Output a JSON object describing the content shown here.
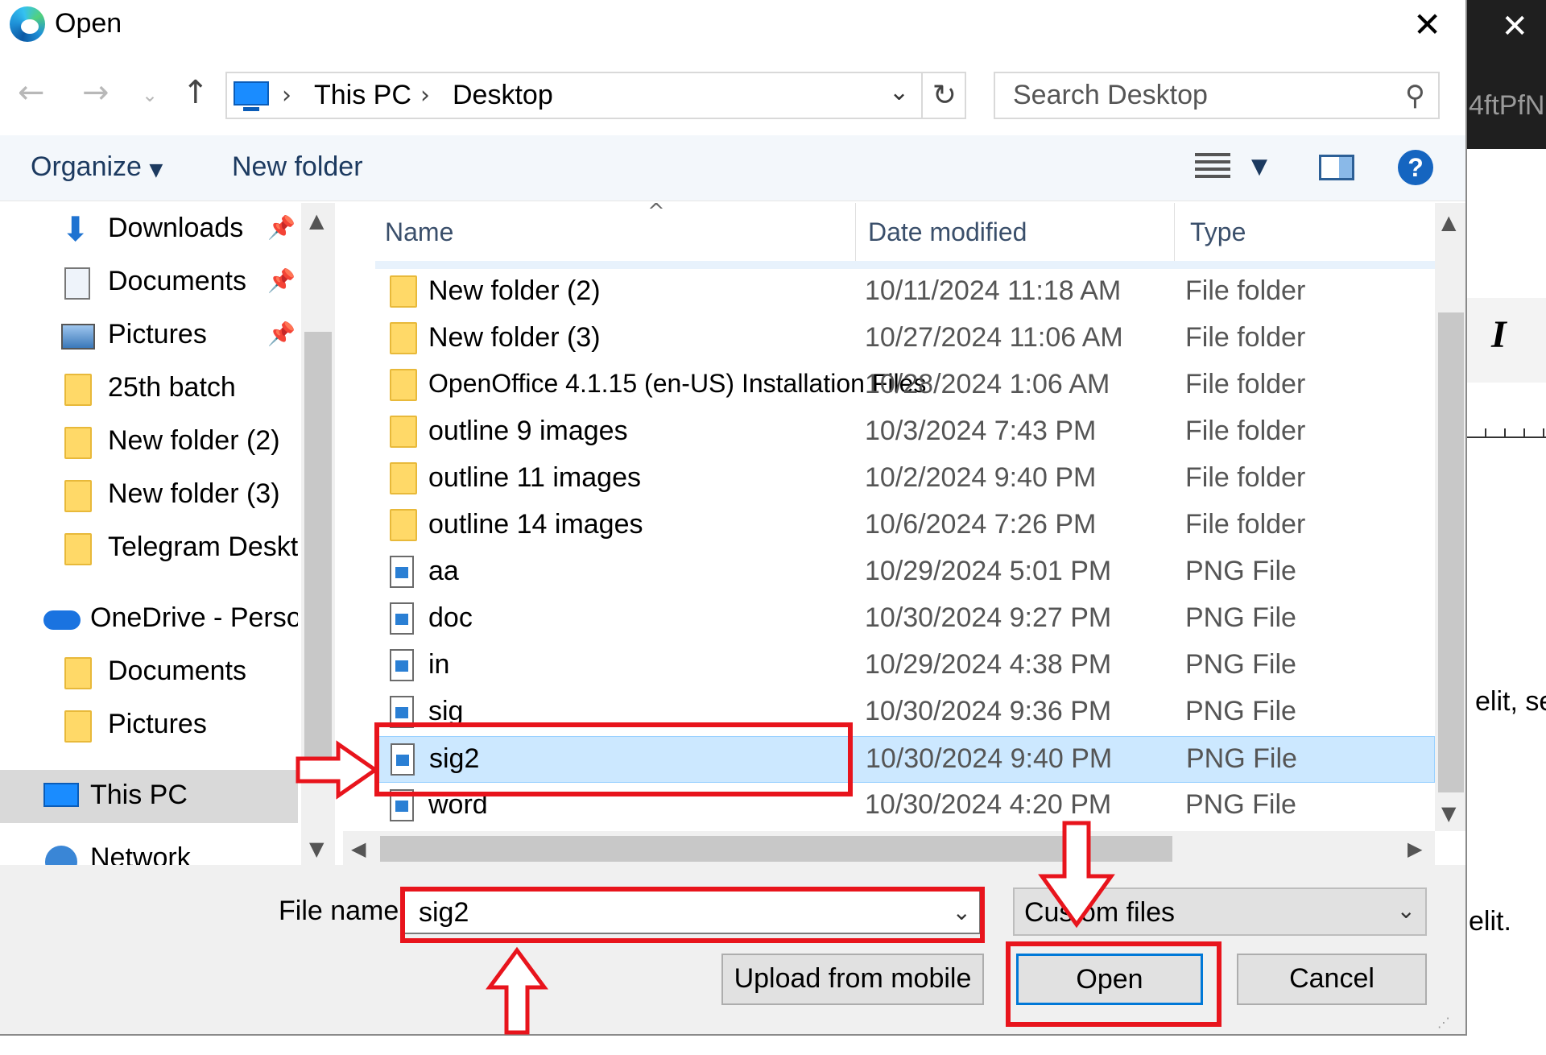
{
  "background_app": {
    "url_fragment": "4ftPfN",
    "italic_label": "I",
    "text_line_1": "elit, se",
    "text_line_2": "elit."
  },
  "dialog": {
    "title": "Open",
    "navigation": {
      "breadcrumb": [
        "This PC",
        "Desktop"
      ],
      "search_placeholder": "Search Desktop"
    },
    "command_bar": {
      "organize_label": "Organize",
      "new_folder_label": "New folder",
      "help_label": "?"
    },
    "nav_pane": {
      "items": [
        {
          "label": "Downloads",
          "icon": "download-arrow-icon",
          "pinned": true
        },
        {
          "label": "Documents",
          "icon": "documents-icon",
          "pinned": true
        },
        {
          "label": "Pictures",
          "icon": "pictures-icon",
          "pinned": true
        },
        {
          "label": "25th batch",
          "icon": "folder-icon",
          "pinned": false
        },
        {
          "label": "New folder (2)",
          "icon": "folder-icon",
          "pinned": false
        },
        {
          "label": "New folder (3)",
          "icon": "folder-icon",
          "pinned": false
        },
        {
          "label": "Telegram Deskto",
          "icon": "folder-icon",
          "pinned": false
        },
        {
          "label": "OneDrive - Persor",
          "icon": "onedrive-cloud-icon",
          "pinned": false
        },
        {
          "label": "Documents",
          "icon": "folder-icon",
          "pinned": false
        },
        {
          "label": "Pictures",
          "icon": "folder-icon",
          "pinned": false
        },
        {
          "label": "This PC",
          "icon": "this-pc-icon",
          "pinned": false,
          "selected": true
        },
        {
          "label": "Network",
          "icon": "network-icon",
          "pinned": false
        }
      ]
    },
    "file_list": {
      "columns": [
        "Name",
        "Date modified",
        "Type"
      ],
      "rows": [
        {
          "name": "New folder (2)",
          "date": "10/11/2024 11:18 AM",
          "type": "File folder",
          "kind": "folder"
        },
        {
          "name": "New folder (3)",
          "date": "10/27/2024 11:06 AM",
          "type": "File folder",
          "kind": "folder"
        },
        {
          "name": "OpenOffice 4.1.15 (en-US) Installation Files",
          "date": "10/28/2024 1:06 AM",
          "type": "File folder",
          "kind": "folder"
        },
        {
          "name": "outline 9 images",
          "date": "10/3/2024 7:43 PM",
          "type": "File folder",
          "kind": "folder"
        },
        {
          "name": "outline 11 images",
          "date": "10/2/2024 9:40 PM",
          "type": "File folder",
          "kind": "folder"
        },
        {
          "name": "outline 14 images",
          "date": "10/6/2024 7:26 PM",
          "type": "File folder",
          "kind": "folder"
        },
        {
          "name": "aa",
          "date": "10/29/2024 5:01 PM",
          "type": "PNG File",
          "kind": "png"
        },
        {
          "name": "doc",
          "date": "10/30/2024 9:27 PM",
          "type": "PNG File",
          "kind": "png"
        },
        {
          "name": "in",
          "date": "10/29/2024 4:38 PM",
          "type": "PNG File",
          "kind": "png"
        },
        {
          "name": "sig",
          "date": "10/30/2024 9:36 PM",
          "type": "PNG File",
          "kind": "png"
        },
        {
          "name": "sig2",
          "date": "10/30/2024 9:40 PM",
          "type": "PNG File",
          "kind": "png",
          "selected": true
        },
        {
          "name": "word",
          "date": "10/30/2024 4:20 PM",
          "type": "PNG File",
          "kind": "png"
        }
      ]
    },
    "footer": {
      "file_name_label": "File name:",
      "file_name_value": "sig2",
      "file_type_value": "Custom files",
      "upload_label": "Upload from mobile",
      "open_label": "Open",
      "cancel_label": "Cancel"
    }
  },
  "colors": {
    "annotation_red": "#e8141c",
    "selection_blue": "#cce8ff",
    "accent_blue": "#0078d7"
  }
}
